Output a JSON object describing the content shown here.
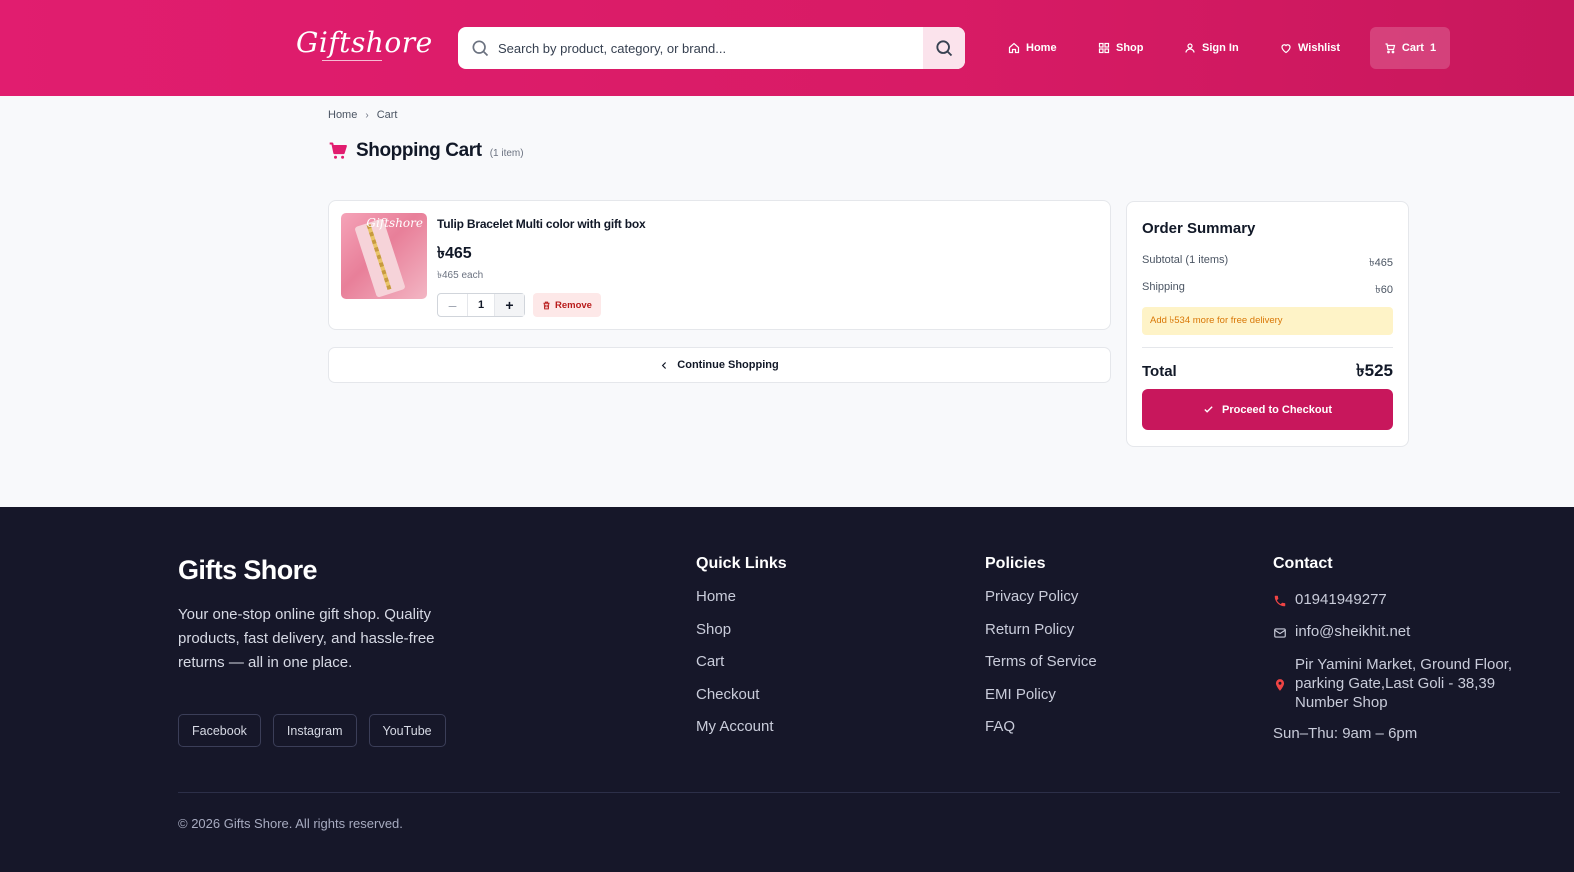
{
  "colors": {
    "brand": "#e11d6f",
    "checkout": "#c8175c",
    "footer_bg": "#161729",
    "notice_bg": "#fef3c7",
    "notice_text": "#d97706"
  },
  "header": {
    "logo": "Giftshore",
    "search_placeholder": "Search by product, category, or brand...",
    "nav": {
      "home": "Home",
      "shop": "Shop",
      "signin": "Sign In",
      "wishlist": "Wishlist",
      "cart": "Cart",
      "cart_count": "1"
    }
  },
  "breadcrumb": {
    "home": "Home",
    "current": "Cart"
  },
  "page": {
    "title": "Shopping Cart",
    "count": "(1 item)"
  },
  "cart_item": {
    "name": "Tulip Bracelet Multi color with gift box",
    "price": "৳465",
    "each": "৳465 each",
    "quantity": "1",
    "remove_label": "Remove",
    "thumb_brand": "Giftshore"
  },
  "continue_label": "Continue Shopping",
  "summary": {
    "title": "Order Summary",
    "subtotal_label": "Subtotal (1 items)",
    "subtotal_value": "৳465",
    "shipping_label": "Shipping",
    "shipping_value": "৳60",
    "notice": "Add ৳534 more for free delivery",
    "total_label": "Total",
    "total_value": "৳525",
    "checkout_label": "Proceed to Checkout"
  },
  "footer": {
    "brand": "Gifts Shore",
    "about": "Your one-stop online gift shop. Quality products, fast delivery, and hassle-free returns — all in one place.",
    "social": [
      "Facebook",
      "Instagram",
      "YouTube"
    ],
    "quick_links": {
      "title": "Quick Links",
      "items": [
        "Home",
        "Shop",
        "Cart",
        "Checkout",
        "My Account"
      ]
    },
    "policies": {
      "title": "Policies",
      "items": [
        "Privacy Policy",
        "Return Policy",
        "Terms of Service",
        "EMI Policy",
        "FAQ"
      ]
    },
    "contact": {
      "title": "Contact",
      "phone": "01941949277",
      "email": "info@sheikhit.net",
      "address": "Pir Yamini Market, Ground Floor, parking Gate,Last Goli - 38,39 Number Shop",
      "hours": "Sun–Thu: 9am – 6pm"
    },
    "copyright": "© 2026 Gifts Shore. All rights reserved."
  }
}
